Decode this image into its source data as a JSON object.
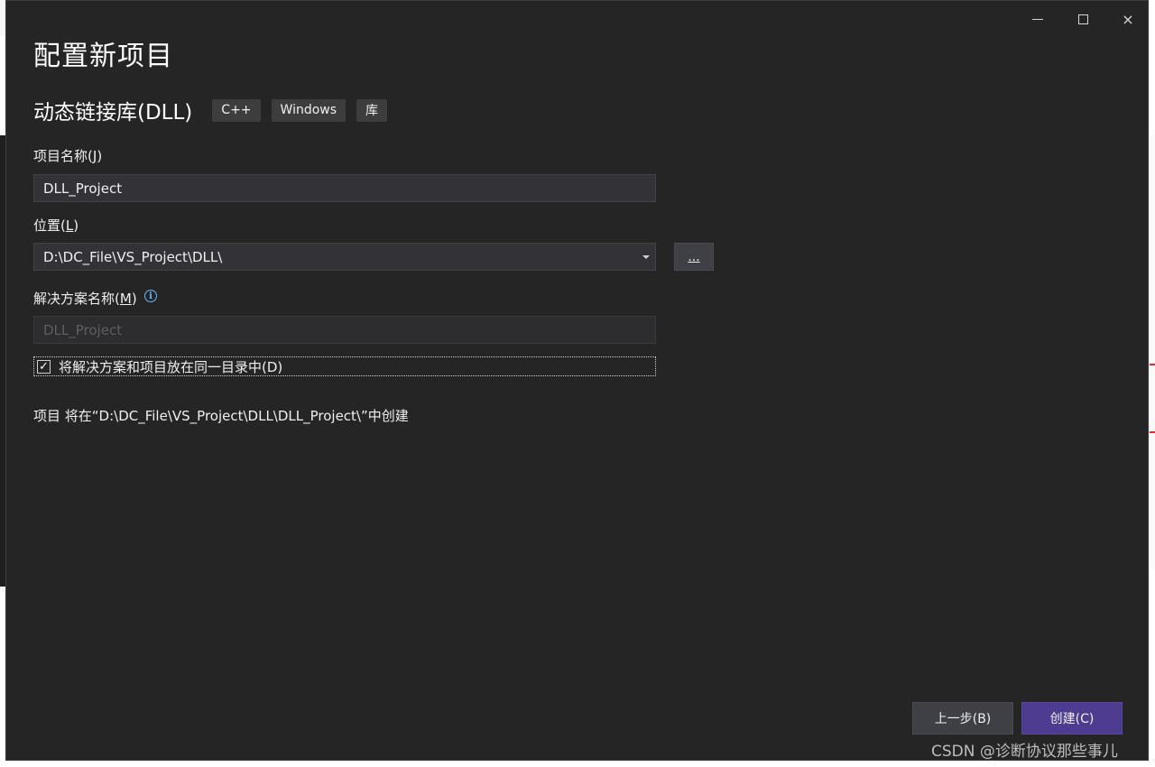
{
  "window_controls": {
    "minimize": "minimize",
    "maximize": "maximize",
    "close": "×"
  },
  "dialog": {
    "title": "配置新项目",
    "template_name": "动态链接库(DLL)",
    "tags": [
      "C++",
      "Windows",
      "库"
    ]
  },
  "project_name": {
    "label": "项目名称",
    "mnemonic": "J",
    "value": "DLL_Project"
  },
  "location": {
    "label": "位置",
    "mnemonic": "L",
    "value": "D:\\DC_File\\VS_Project\\DLL\\",
    "browse_label": "..."
  },
  "solution_name": {
    "label": "解决方案名称",
    "mnemonic": "M",
    "placeholder": "DLL_Project",
    "info_icon": "info-icon"
  },
  "same_dir_checkbox": {
    "checked": true,
    "check_glyph": "✓",
    "label": "将解决方案和项目放在同一目录中(D)"
  },
  "creation_path_text": "项目 将在“D:\\DC_File\\VS_Project\\DLL\\DLL_Project\\”中创建",
  "footer": {
    "back_label": "上一步(B)",
    "create_label": "创建(C)"
  },
  "watermark": "CSDN @诊断协议那些事儿",
  "colors": {
    "dialog_bg": "#252526",
    "input_bg": "#333337",
    "create_button": "#4d3c8f",
    "info_accent": "#6cb8f6"
  }
}
